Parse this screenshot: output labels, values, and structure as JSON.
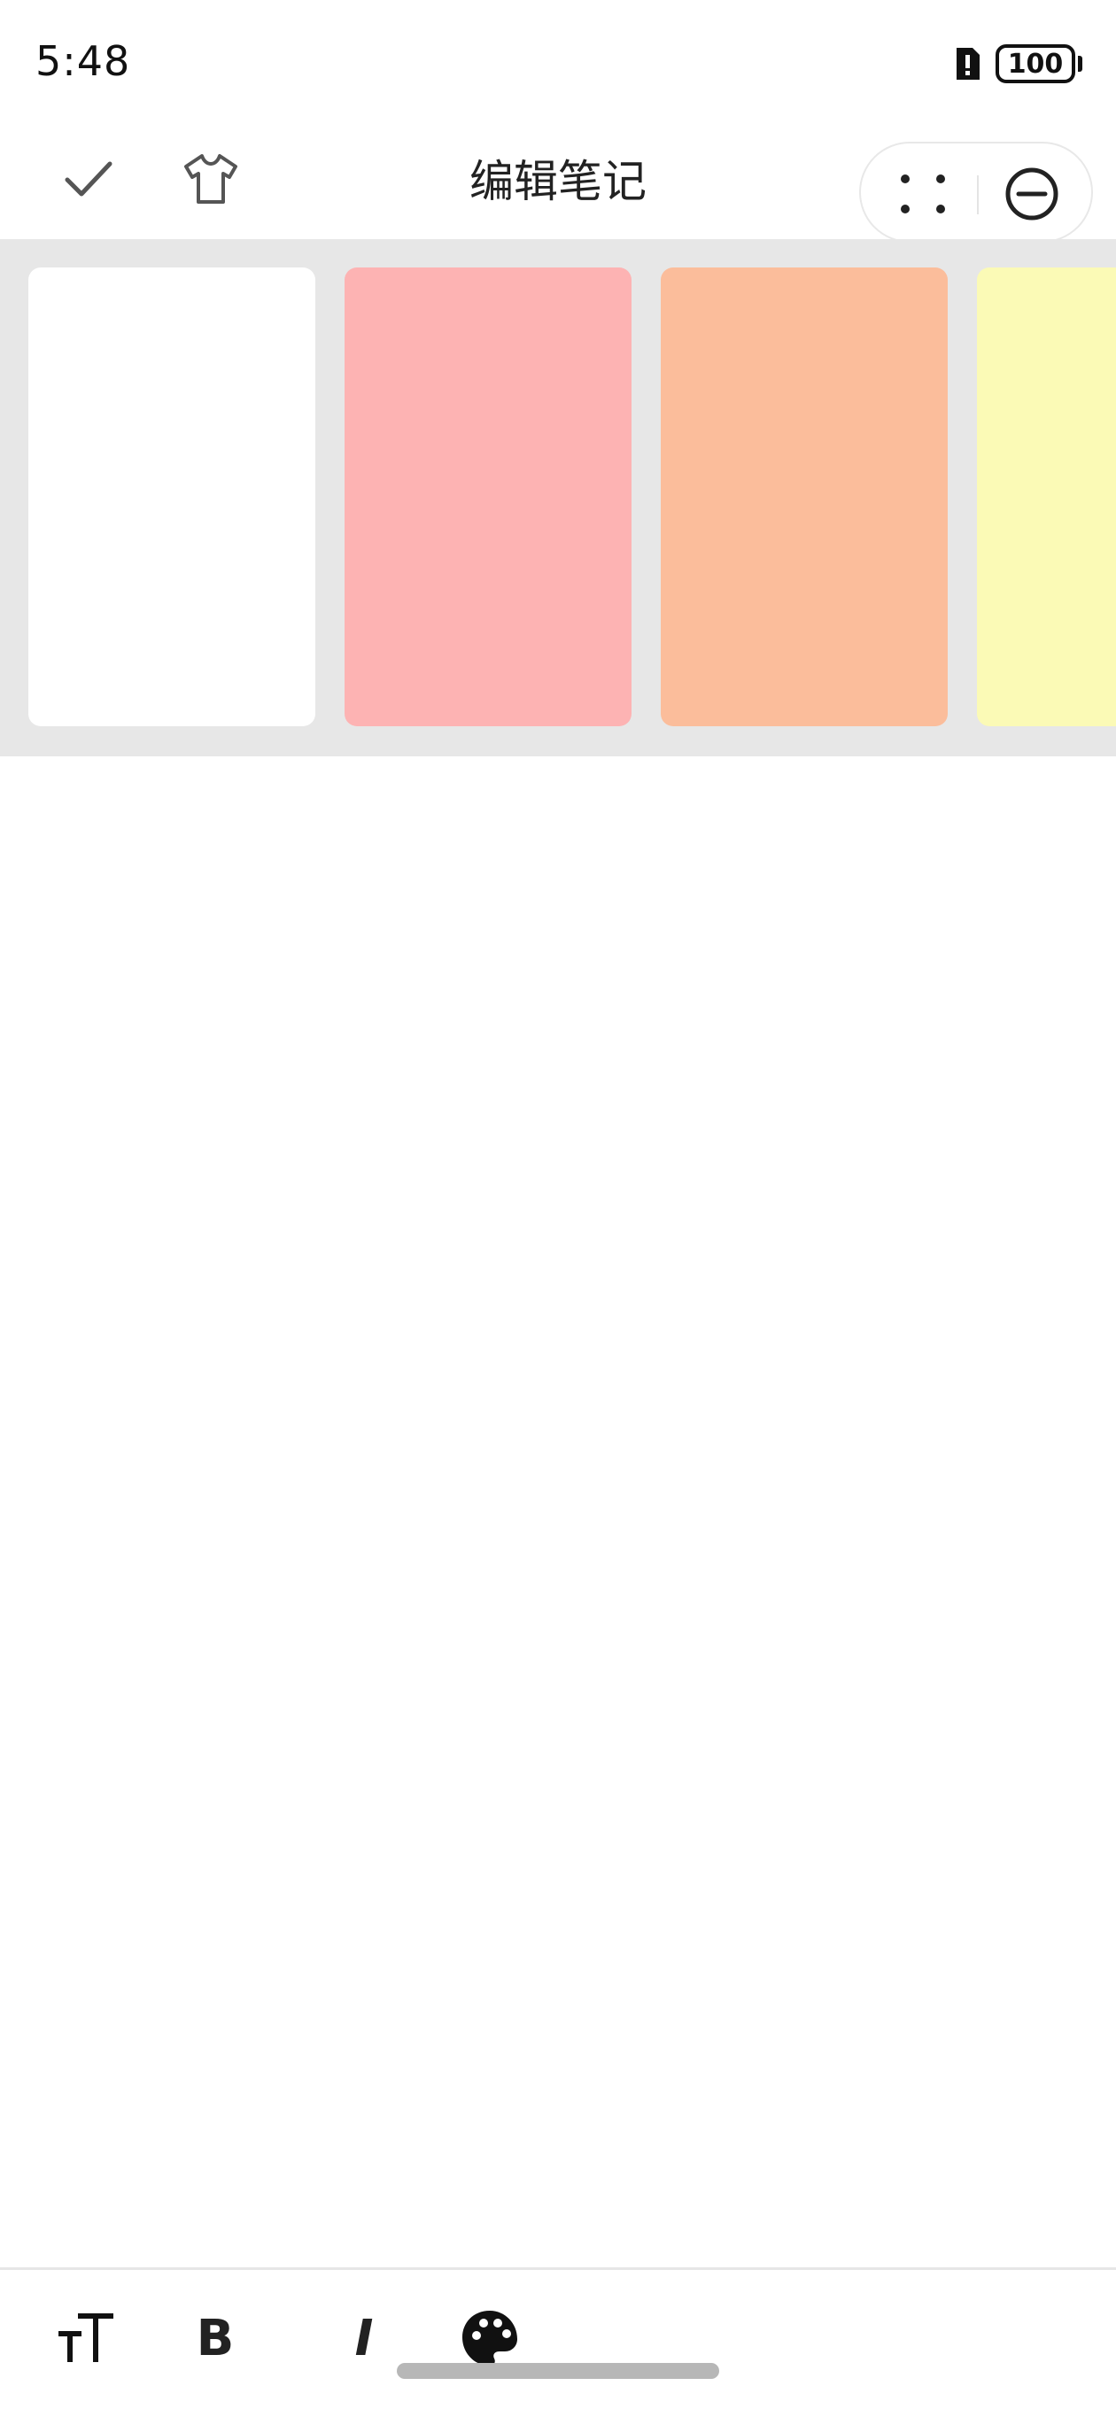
{
  "status_bar": {
    "time": "5:48",
    "battery_level": "100",
    "sim_icon": "sim-alert-icon"
  },
  "header": {
    "title": "编辑笔记",
    "confirm_icon": "check-icon",
    "theme_icon": "shirt-icon",
    "more_icon": "more-dots-icon",
    "close_icon": "close-circle-icon"
  },
  "color_swatches": [
    {
      "name": "white",
      "color": "#ffffff"
    },
    {
      "name": "pink",
      "color": "#fdb3b3"
    },
    {
      "name": "orange",
      "color": "#fbbd9b"
    },
    {
      "name": "yellow",
      "color": "#fbfab6"
    }
  ],
  "toolbar": {
    "text_size_icon": "text-size-icon",
    "bold_label": "B",
    "italic_label": "I",
    "palette_icon": "palette-icon"
  },
  "colors": {
    "strip_background": "#e7e7e7",
    "text_primary": "#222222",
    "home_indicator": "#b7b7b7"
  }
}
